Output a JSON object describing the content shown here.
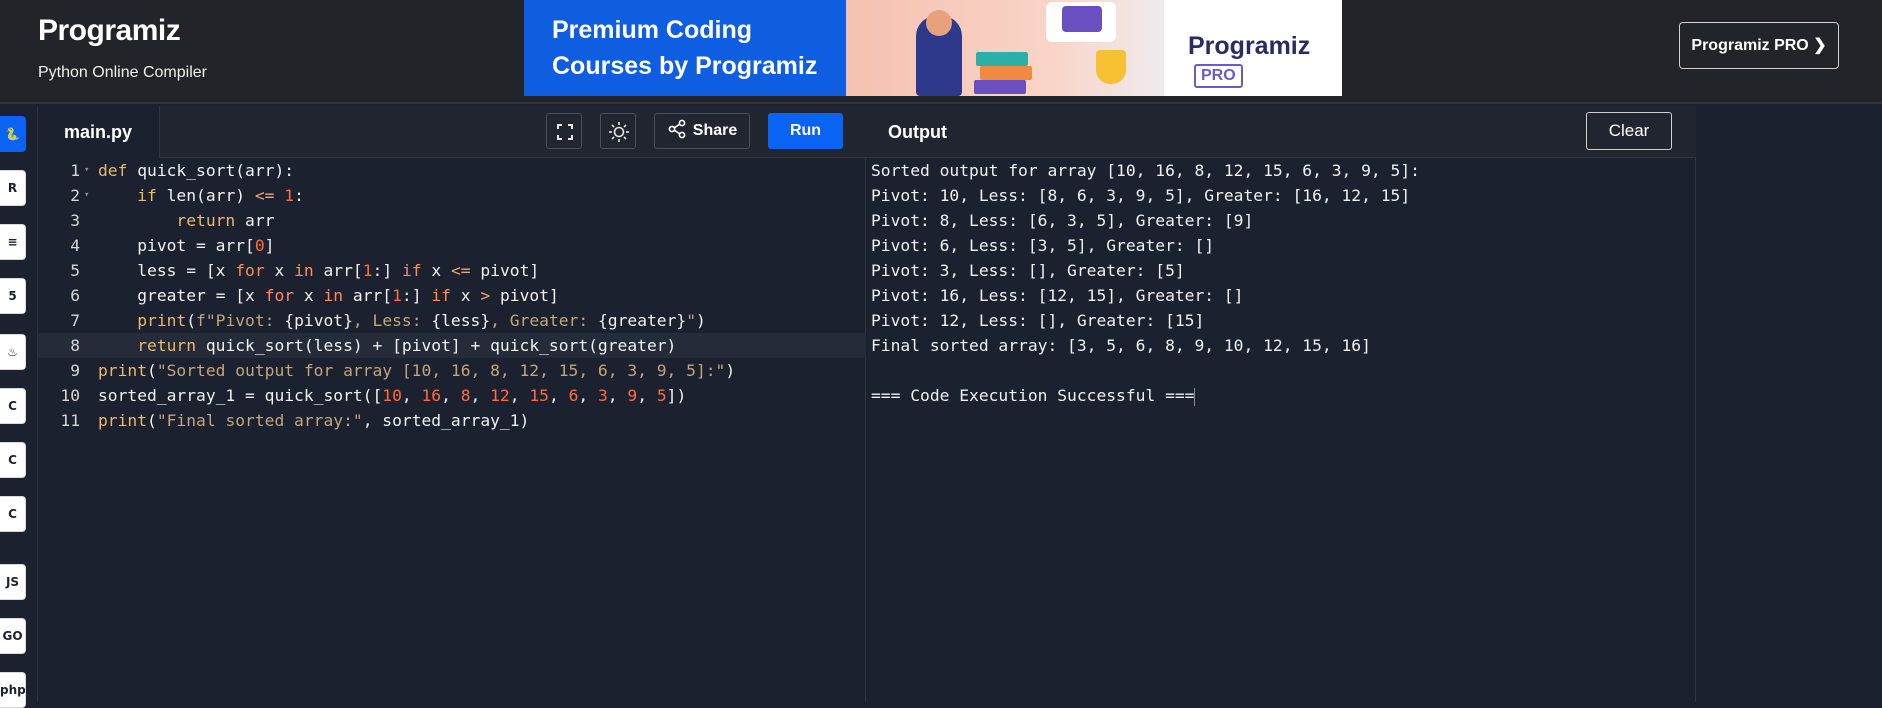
{
  "header": {
    "logo": "Programiz",
    "subtitle": "Python Online Compiler",
    "banner_line1": "Premium Coding",
    "banner_line2": "Courses by Programiz",
    "banner_logo": "Programiz",
    "banner_pro": "PRO",
    "pro_button": "Programiz PRO ❯"
  },
  "languages": [
    {
      "name": "python-icon",
      "glyph": "🐍",
      "active": true
    },
    {
      "name": "r-icon",
      "glyph": "R"
    },
    {
      "name": "sql-icon",
      "glyph": "≡"
    },
    {
      "name": "html-icon",
      "glyph": "5"
    },
    {
      "name": "java-icon",
      "glyph": "♨"
    },
    {
      "name": "c-icon",
      "glyph": "C"
    },
    {
      "name": "cpp-icon",
      "glyph": "C"
    },
    {
      "name": "csharp-icon",
      "glyph": "C"
    },
    {
      "name": "js-icon",
      "glyph": "JS"
    },
    {
      "name": "go-icon",
      "glyph": "GO"
    },
    {
      "name": "php-icon",
      "glyph": "php"
    }
  ],
  "editor": {
    "filename": "main.py",
    "share_label": "Share",
    "run_label": "Run",
    "lines": [
      "def quick_sort(arr):",
      "    if len(arr) <= 1:",
      "        return arr",
      "    pivot = arr[0]",
      "    less = [x for x in arr[1:] if x <= pivot]",
      "    greater = [x for x in arr[1:] if x > pivot]",
      "    print(f\"Pivot: {pivot}, Less: {less}, Greater: {greater}\")",
      "    return quick_sort(less) + [pivot] + quick_sort(greater)",
      "print(\"Sorted output for array [10, 16, 8, 12, 15, 6, 3, 9, 5]:\")",
      "sorted_array_1 = quick_sort([10, 16, 8, 12, 15, 6, 3, 9, 5])",
      "print(\"Final sorted array:\", sorted_array_1)"
    ]
  },
  "output": {
    "title": "Output",
    "clear_label": "Clear",
    "lines": [
      "Sorted output for array [10, 16, 8, 12, 15, 6, 3, 9, 5]:",
      "Pivot: 10, Less: [8, 6, 3, 9, 5], Greater: [16, 12, 15]",
      "Pivot: 8, Less: [6, 3, 5], Greater: [9]",
      "Pivot: 6, Less: [3, 5], Greater: []",
      "Pivot: 3, Less: [], Greater: [5]",
      "Pivot: 16, Less: [12, 15], Greater: []",
      "Pivot: 12, Less: [], Greater: [15]",
      "Final sorted array: [3, 5, 6, 8, 9, 10, 12, 15, 16]",
      "",
      "=== Code Execution Successful ==="
    ]
  },
  "colors": {
    "accent": "#0b63f6",
    "background": "#1c2130",
    "header": "#212428"
  }
}
